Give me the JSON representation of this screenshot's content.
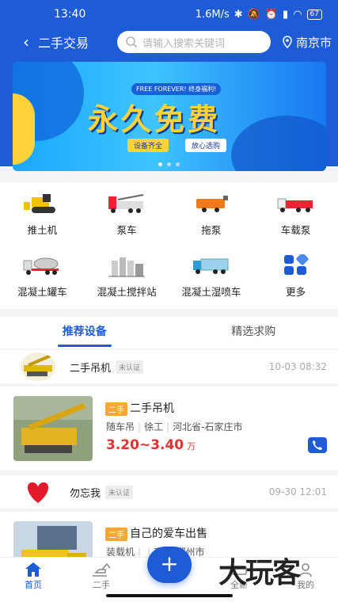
{
  "status_bar": {
    "time": "13:40",
    "speed": "1.6M/s",
    "battery": "67"
  },
  "nav": {
    "title": "二手交易",
    "search_placeholder": "请输入搜索关键词",
    "city": "南京市"
  },
  "banner": {
    "top_tag": "FREE FOREVER! 终身福利!",
    "headline": "永久免费",
    "pill_left": "设备齐全",
    "pill_right": "放心选购"
  },
  "categories": [
    {
      "label": "推土机",
      "icon": "bulldozer-icon"
    },
    {
      "label": "泵车",
      "icon": "pump-truck-icon"
    },
    {
      "label": "拖泵",
      "icon": "trailer-pump-icon"
    },
    {
      "label": "车载泵",
      "icon": "truck-mounted-pump-icon"
    },
    {
      "label": "混凝土罐车",
      "icon": "mixer-truck-icon"
    },
    {
      "label": "混凝土搅拌站",
      "icon": "mixing-plant-icon"
    },
    {
      "label": "混凝土湿喷车",
      "icon": "wet-spray-truck-icon"
    },
    {
      "label": "更多",
      "icon": "more-grid-icon"
    }
  ],
  "tabs": [
    {
      "label": "推荐设备"
    },
    {
      "label": "精选求购"
    }
  ],
  "posts": [
    {
      "user": "二手吊机",
      "verify": "未认证",
      "time": "10-03 08:32",
      "tag": "二手",
      "title": "二手吊机",
      "meta": [
        "随车吊",
        "徐工",
        "河北省-石家庄市"
      ],
      "price": "3.20~3.40",
      "unit": "万"
    },
    {
      "user": "勿忘我",
      "verify": "未认证",
      "time": "09-30 12:01",
      "tag": "二手",
      "title": "自己的爱车出售",
      "meta": [
        "装载机",
        "",
        "南省-郑州市"
      ]
    }
  ],
  "bottom_nav": [
    {
      "label": "首页"
    },
    {
      "label": "二手"
    },
    {
      "label": "全新"
    },
    {
      "label": "我的"
    }
  ],
  "fab": "+",
  "watermark": "大玩客",
  "colors": {
    "brand_blue": "#1e5bd6",
    "price_red": "#e63030",
    "tag_orange": "#f7a735"
  }
}
